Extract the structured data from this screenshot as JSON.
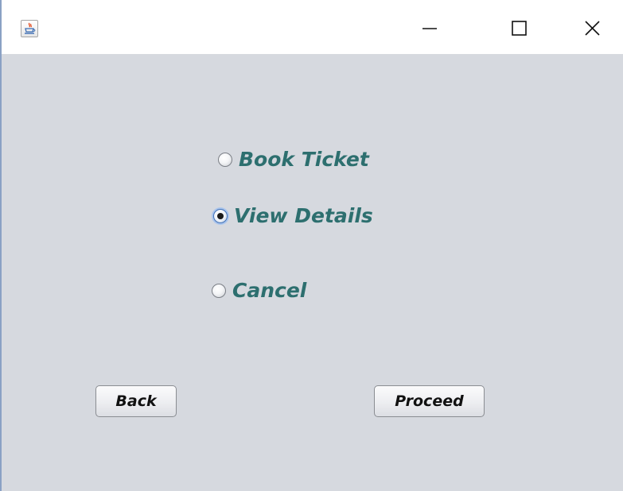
{
  "window": {
    "icon": "java-cup-icon",
    "controls": [
      "minimize-icon",
      "maximize-icon",
      "close-icon"
    ]
  },
  "options": {
    "book_ticket": {
      "label": "Book Ticket",
      "selected": false
    },
    "view_details": {
      "label": "View Details",
      "selected": true
    },
    "cancel": {
      "label": "Cancel",
      "selected": false
    }
  },
  "buttons": {
    "back_label": "Back",
    "proceed_label": "Proceed"
  },
  "colors": {
    "content_background": "#d6d9df",
    "option_text": "#2d6f6f",
    "selected_ring": "#3d6fb8"
  }
}
